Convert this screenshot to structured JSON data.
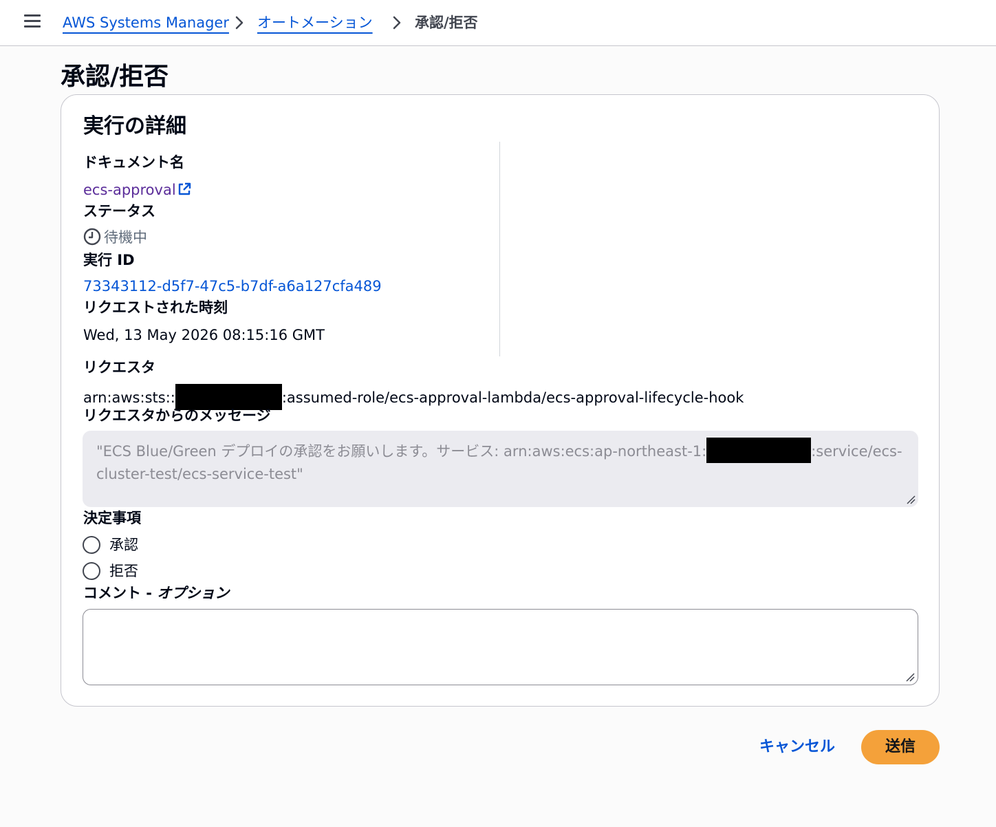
{
  "breadcrumb": {
    "items": [
      {
        "label": "AWS Systems Manager"
      },
      {
        "label": "オートメーション"
      }
    ],
    "current": "承認/拒否"
  },
  "page": {
    "title": "承認/拒否"
  },
  "details": {
    "section_title": "実行の詳細",
    "document_label": "ドキュメント名",
    "document_value": "ecs-approval",
    "status_label": "ステータス",
    "status_value": "待機中",
    "execution_id_label": "実行 ID",
    "execution_id_value": "73343112-d5f7-47c5-b7df-a6a127cfa489",
    "requested_time_label": "リクエストされた時刻",
    "requested_time_value": "Wed, 13 May 2026 08:15:16 GMT",
    "requester_label": "リクエスタ",
    "requester_prefix": "arn:aws:sts::",
    "requester_suffix": ":assumed-role/ecs-approval-lambda/ecs-approval-lifecycle-hook",
    "message_label": "リクエスタからのメッセージ",
    "message_part1": "\"ECS Blue/Green デプロイの承認をお願いします。サービス: arn:aws:ecs:ap-northeast-1:",
    "message_part2": ":service/ecs-cluster-test/ecs-service-test\""
  },
  "decision": {
    "label": "決定事項",
    "options": [
      {
        "label": "承認",
        "selected": false
      },
      {
        "label": "拒否",
        "selected": false
      }
    ]
  },
  "comment": {
    "label_main": "コメント - ",
    "label_optional": "オプション",
    "value": ""
  },
  "actions": {
    "cancel_label": "キャンセル",
    "submit_label": "送信"
  },
  "colors": {
    "link": "#0656d6",
    "visited_link": "#5b2d9a",
    "primary_button": "#f4a13a",
    "text": "#000716"
  }
}
